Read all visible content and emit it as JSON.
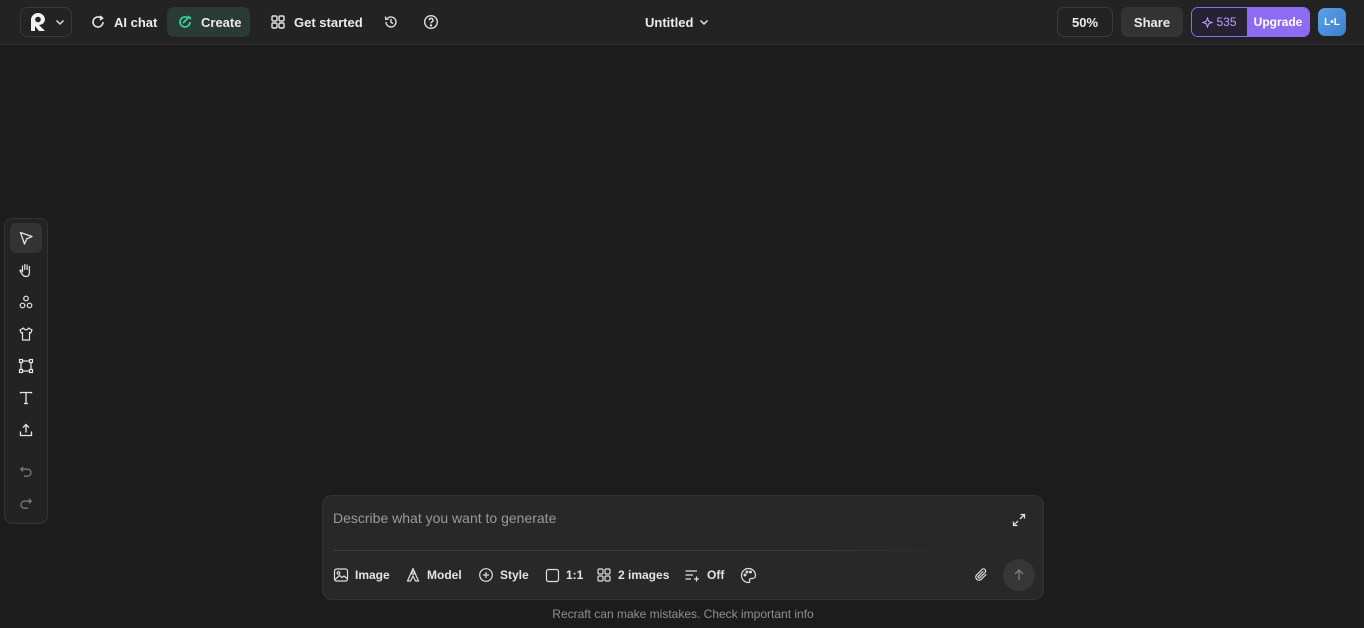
{
  "topbar": {
    "logo_icon": "recraft-logo-icon",
    "nav": {
      "ai_chat": "AI chat",
      "create": "Create",
      "get_started": "Get started"
    },
    "document_title": "Untitled",
    "zoom": "50%",
    "share": "Share",
    "credits": "535",
    "upgrade": "Upgrade",
    "avatar_initials": "L•L"
  },
  "toolbar": {
    "tools": [
      "select",
      "hand",
      "shapes",
      "mockup",
      "frame",
      "text",
      "upload",
      "undo",
      "redo"
    ]
  },
  "prompt": {
    "placeholder": "Describe what you want to generate",
    "options": {
      "image": "Image",
      "model": "Model",
      "style": "Style",
      "ratio": "1:1",
      "count": "2 images",
      "enhance": "Off"
    }
  },
  "disclaimer": "Recraft can make mistakes. Check important info",
  "colors": {
    "background": "#1c1c1c",
    "accent_purple": "#8d6cf3",
    "active_create": "#2a3b36",
    "create_icon": "#3fd6a5"
  }
}
